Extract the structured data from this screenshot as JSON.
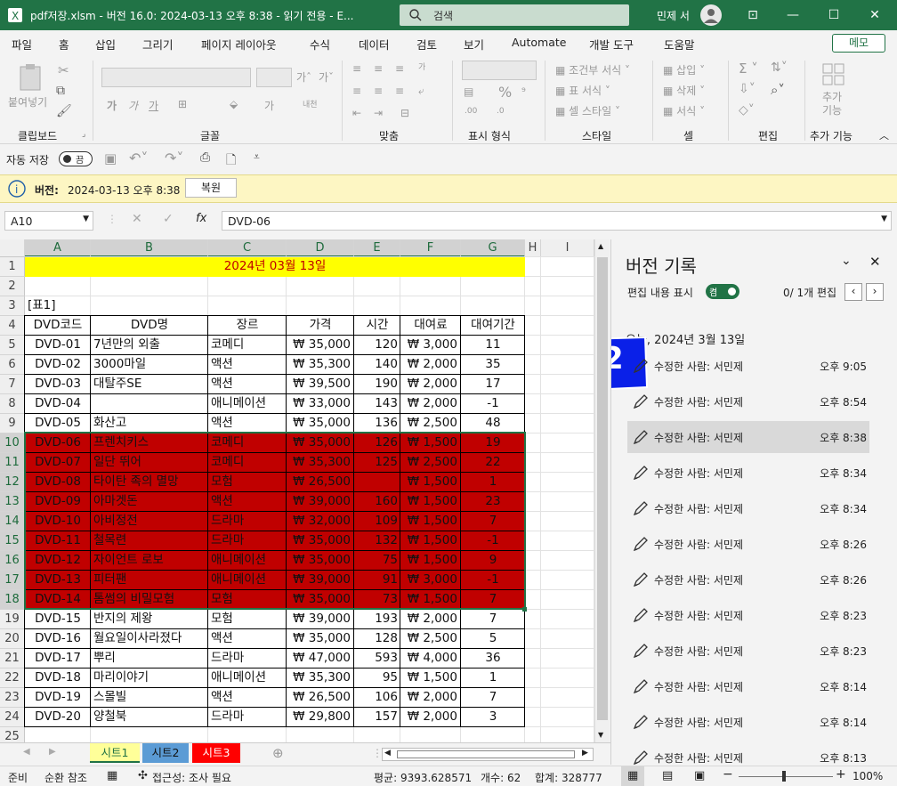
{
  "titlebar": {
    "title": "pdf저장.xlsm  -  버전 16.0: 2024-03-13 오후 8:38  -  읽기 전용  -  E...",
    "search_placeholder": "검색",
    "user": "민제 서"
  },
  "menu": [
    "파일",
    "홈",
    "삽입",
    "그리기",
    "페이지 레이아웃",
    "수식",
    "데이터",
    "검토",
    "보기",
    "Automate",
    "개발 도구",
    "도움말"
  ],
  "memo_label": "메모",
  "ribbon": {
    "groups": [
      "클립보드",
      "글꼴",
      "맞춤",
      "표시 형식",
      "스타일",
      "셀",
      "편집",
      "추가 기능"
    ],
    "paste": "붙여넣기",
    "cond_format": "조건부 서식",
    "table_format": "표 서식",
    "cell_style": "셀 스타일",
    "insert": "삽입",
    "delete": "삭제",
    "format": "서식",
    "addin": "추가\n기능"
  },
  "qat": {
    "autosave": "자동 저장",
    "toggle": "끔"
  },
  "infobar": {
    "label": "버전:",
    "value": "2024-03-13 오후 8:38",
    "restore": "복원"
  },
  "namebox": "A10",
  "formula": "DVD-06",
  "columns": [
    "A",
    "B",
    "C",
    "D",
    "E",
    "F",
    "G",
    "H",
    "I"
  ],
  "rows": [
    "1",
    "2",
    "3",
    "4",
    "5",
    "6",
    "7",
    "8",
    "9",
    "10",
    "11",
    "12",
    "13",
    "14",
    "15",
    "16",
    "17",
    "18",
    "19",
    "20",
    "21",
    "22",
    "23",
    "24",
    "25"
  ],
  "title_cell": "2024년 03월 13일",
  "table_label": "[표1]",
  "headers": [
    "DVD코드",
    "DVD명",
    "장르",
    "가격",
    "시간",
    "대여료",
    "대여기간"
  ],
  "table_rows": [
    [
      "DVD-01",
      "7년만의 외출",
      "코메디",
      "₩ 35,000",
      "120",
      "₩ 3,000",
      "11"
    ],
    [
      "DVD-02",
      "3000마일",
      "액션",
      "₩ 35,300",
      "140",
      "₩ 2,000",
      "35"
    ],
    [
      "DVD-03",
      "대탈주SE",
      "액션",
      "₩ 39,500",
      "190",
      "₩ 2,000",
      "17"
    ],
    [
      "DVD-04",
      "",
      "애니메이션",
      "₩ 33,000",
      "143",
      "₩ 2,000",
      "-1"
    ],
    [
      "DVD-05",
      "화산고",
      "액션",
      "₩ 35,000",
      "136",
      "₩ 2,500",
      "48"
    ],
    [
      "DVD-06",
      "프렌치키스",
      "코메디",
      "₩ 35,000",
      "126",
      "₩ 1,500",
      "19"
    ],
    [
      "DVD-07",
      "일단 뛰어",
      "코메디",
      "₩ 35,300",
      "125",
      "₩ 2,500",
      "22"
    ],
    [
      "DVD-08",
      "타이탄 족의 멸망",
      "모험",
      "₩ 26,500",
      "",
      "₩ 1,500",
      "1"
    ],
    [
      "DVD-09",
      "아마겟돈",
      "액션",
      "₩ 39,000",
      "160",
      "₩ 1,500",
      "23"
    ],
    [
      "DVD-10",
      "아비정전",
      "드라마",
      "₩ 32,000",
      "109",
      "₩ 1,500",
      "7"
    ],
    [
      "DVD-11",
      "철목련",
      "드라마",
      "₩ 35,000",
      "132",
      "₩ 1,500",
      "-1"
    ],
    [
      "DVD-12",
      "자이언트 로보",
      "애니메이션",
      "₩ 35,000",
      "75",
      "₩ 1,500",
      "9"
    ],
    [
      "DVD-13",
      "피터팬",
      "애니메이션",
      "₩ 39,000",
      "91",
      "₩ 3,000",
      "-1"
    ],
    [
      "DVD-14",
      "톰썸의 비밀모험",
      "모험",
      "₩ 35,000",
      "73",
      "₩ 1,500",
      "7"
    ],
    [
      "DVD-15",
      "반지의 제왕",
      "모험",
      "₩ 39,000",
      "193",
      "₩ 2,000",
      "7"
    ],
    [
      "DVD-16",
      "월요일이사라졌다",
      "액션",
      "₩ 35,000",
      "128",
      "₩ 2,500",
      "5"
    ],
    [
      "DVD-17",
      "뿌리",
      "드라마",
      "₩ 47,000",
      "593",
      "₩ 4,000",
      "36"
    ],
    [
      "DVD-18",
      "마리이야기",
      "애니메이션",
      "₩ 35,300",
      "95",
      "₩ 1,500",
      "1"
    ],
    [
      "DVD-19",
      "스몰빌",
      "액션",
      "₩ 26,500",
      "106",
      "₩ 2,000",
      "7"
    ],
    [
      "DVD-20",
      "양철북",
      "드라마",
      "₩ 29,800",
      "157",
      "₩ 2,000",
      "3"
    ]
  ],
  "sheets": [
    "시트1",
    "시트2",
    "시트3"
  ],
  "status": {
    "ready": "준비",
    "circular": "순환 참조",
    "accessibility": "접근성: 조사 필요",
    "average": "평균: 9393.628571",
    "count": "개수: 62",
    "sum": "합계: 328777",
    "zoom": "100%"
  },
  "panel": {
    "title": "버전 기록",
    "show_edits": "편집 내용 표시",
    "toggle": "켬",
    "edit_count": "0/ 1개 편집",
    "date_header": "오늘, 2024년 3월 13일",
    "callout": "2",
    "versions": [
      {
        "who": "수정한 사람: 서민제",
        "time": "오후 9:05"
      },
      {
        "who": "수정한 사람: 서민제",
        "time": "오후 8:54"
      },
      {
        "who": "수정한 사람: 서민제",
        "time": "오후 8:38"
      },
      {
        "who": "수정한 사람: 서민제",
        "time": "오후 8:34"
      },
      {
        "who": "수정한 사람: 서민제",
        "time": "오후 8:34"
      },
      {
        "who": "수정한 사람: 서민제",
        "time": "오후 8:26"
      },
      {
        "who": "수정한 사람: 서민제",
        "time": "오후 8:26"
      },
      {
        "who": "수정한 사람: 서민제",
        "time": "오후 8:23"
      },
      {
        "who": "수정한 사람: 서민제",
        "time": "오후 8:23"
      },
      {
        "who": "수정한 사람: 서민제",
        "time": "오후 8:14"
      },
      {
        "who": "수정한 사람: 서민제",
        "time": "오후 8:14"
      },
      {
        "who": "수정한 사람: 서민제",
        "time": "오후 8:13"
      }
    ]
  },
  "colors": {
    "excel_green": "#217346",
    "highlight_red": "#c00000",
    "title_yellow": "#ffff00",
    "info_yellow": "#fdf6c3"
  }
}
